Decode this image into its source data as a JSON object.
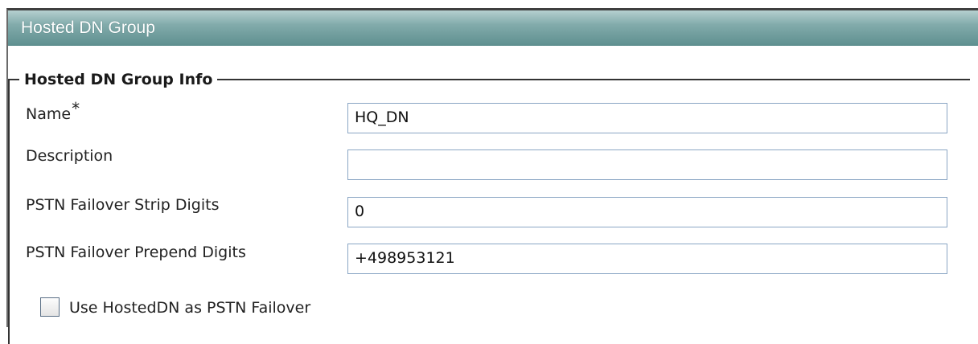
{
  "header": {
    "title": "Hosted DN Group"
  },
  "group": {
    "legend": "Hosted DN Group Info",
    "fields": [
      {
        "label": "Name",
        "required_marker": "*",
        "value": "HQ_DN"
      },
      {
        "label": "Description",
        "value": ""
      },
      {
        "label": "PSTN Failover Strip Digits",
        "value": "0"
      },
      {
        "label": "PSTN Failover Prepend Digits",
        "value": "+498953121"
      }
    ],
    "checkbox": {
      "label": "Use HostedDN as PSTN Failover",
      "checked": false
    }
  },
  "colors": {
    "header_gradient_top": "#b5d0d0",
    "header_gradient_bottom": "#5e8f8f",
    "input_border": "#8aa6c4"
  }
}
